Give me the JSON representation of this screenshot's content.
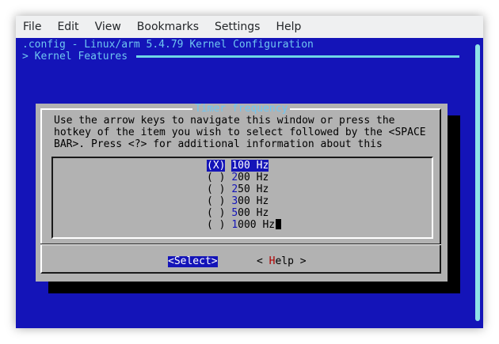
{
  "menubar": {
    "items": [
      "File",
      "Edit",
      "View",
      "Bookmarks",
      "Settings",
      "Help"
    ]
  },
  "terminal": {
    "title": ".config - Linux/arm 5.4.79 Kernel Configuration",
    "breadcrumb": "> Kernel Features"
  },
  "dialog": {
    "title": "Timer frequency",
    "help_lines": [
      "Use the arrow keys to navigate this window or press the",
      "hotkey of the item you wish to select followed by the <SPACE",
      "BAR>. Press <?> for additional information about this"
    ],
    "options": [
      {
        "radio": "(X)",
        "hotkey": "1",
        "rest": "00 Hz",
        "selected": true
      },
      {
        "radio": "( )",
        "hotkey": "2",
        "rest": "00 Hz",
        "selected": false
      },
      {
        "radio": "( )",
        "hotkey": "2",
        "rest": "50 Hz",
        "selected": false
      },
      {
        "radio": "( )",
        "hotkey": "3",
        "rest": "00 Hz",
        "selected": false
      },
      {
        "radio": "( )",
        "hotkey": "5",
        "rest": "00 Hz",
        "selected": false
      },
      {
        "radio": "( )",
        "hotkey": "1",
        "rest": "000 Hz",
        "selected": false
      }
    ],
    "buttons": {
      "select_label": "<Select>",
      "help_prefix": "< ",
      "help_hotkey": "H",
      "help_rest": "elp >"
    }
  },
  "colors": {
    "terminal_bg": "#1414b8",
    "dialog_bg": "#b2b2b2",
    "accent_text": "#6fc6f0"
  }
}
